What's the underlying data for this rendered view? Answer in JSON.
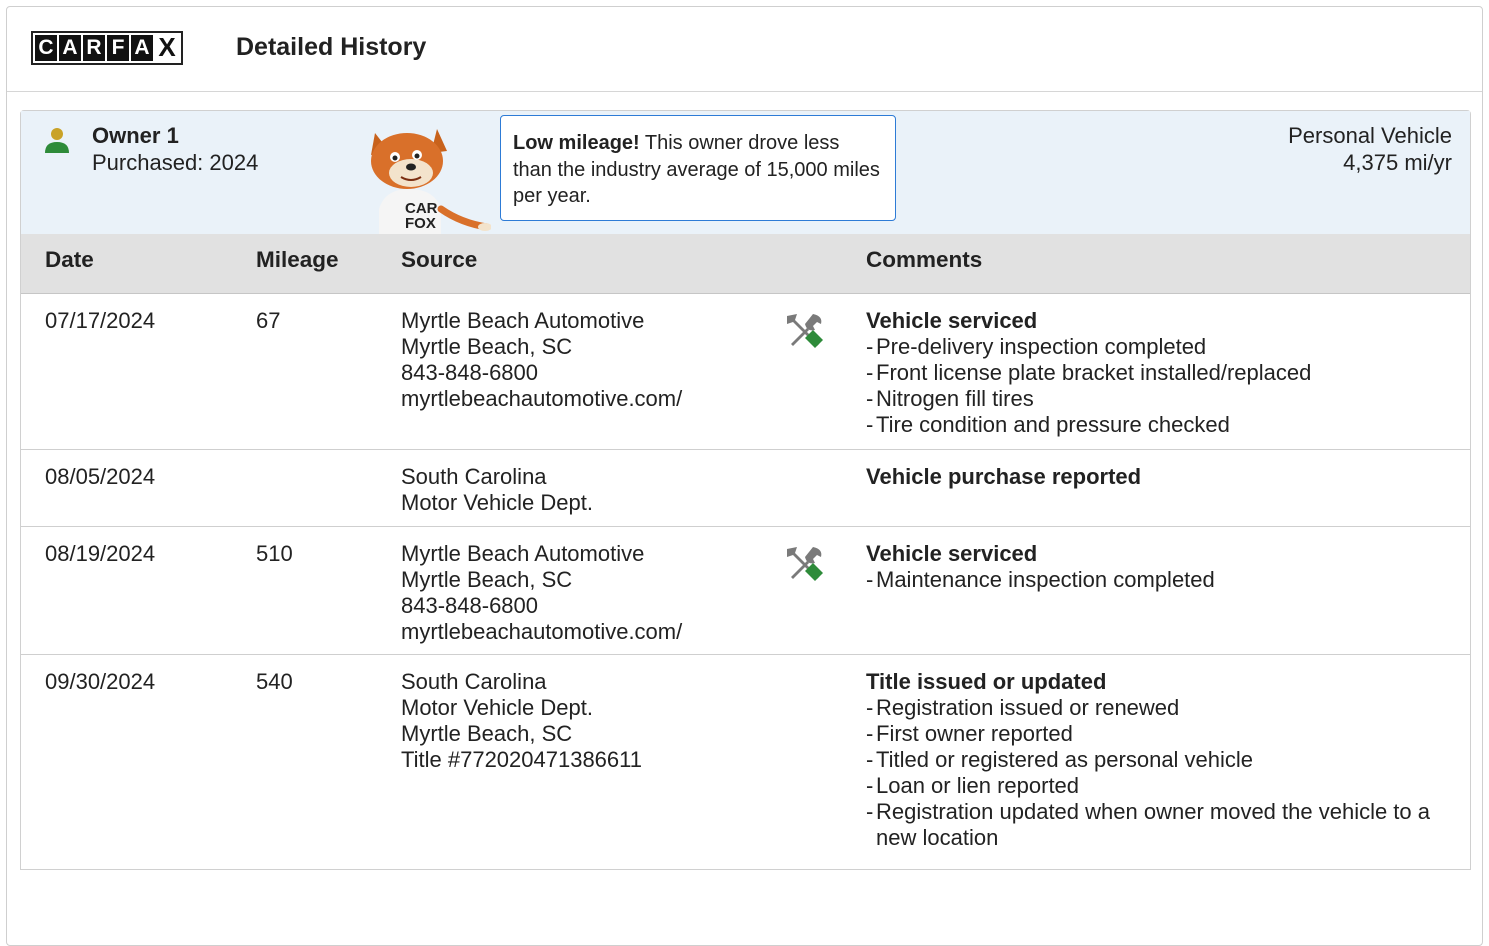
{
  "header": {
    "logo_letters": [
      "C",
      "A",
      "R",
      "F",
      "A",
      "X"
    ],
    "title": "Detailed History"
  },
  "owner": {
    "title": "Owner 1",
    "purchased": "Purchased: 2024",
    "callout_bold": "Low mileage!",
    "callout_text": " This owner drove less than the industry average of 15,000 miles per year.",
    "vehicle_type": "Personal Vehicle",
    "mileage_per_year": "4,375 mi/yr",
    "mascot_shirt": "CAR FOX",
    "person_icon": "person-icon",
    "person_icon_color": "#2e8b3a"
  },
  "table": {
    "columns": [
      "Date",
      "Mileage",
      "Source",
      "Comments"
    ],
    "rows": [
      {
        "date": "07/17/2024",
        "mileage": "67",
        "source": [
          "Myrtle Beach Automotive",
          "Myrtle Beach, SC",
          "843-848-6800",
          "myrtlebeachautomotive.com/"
        ],
        "icon": "service-tools-icon",
        "comment_title": "Vehicle serviced",
        "comment_items": [
          "Pre-delivery inspection completed",
          "Front license plate bracket installed/replaced",
          "Nitrogen fill tires",
          "Tire condition and pressure checked"
        ]
      },
      {
        "date": "08/05/2024",
        "mileage": "",
        "source": [
          "South Carolina",
          "Motor Vehicle Dept."
        ],
        "icon": "",
        "comment_title": "Vehicle purchase reported",
        "comment_items": []
      },
      {
        "date": "08/19/2024",
        "mileage": "510",
        "source": [
          "Myrtle Beach Automotive",
          "Myrtle Beach, SC",
          "843-848-6800",
          "myrtlebeachautomotive.com/"
        ],
        "icon": "service-tools-icon",
        "comment_title": "Vehicle serviced",
        "comment_items": [
          "Maintenance inspection completed"
        ]
      },
      {
        "date": "09/30/2024",
        "mileage": "540",
        "source": [
          "South Carolina",
          "Motor Vehicle Dept.",
          "Myrtle Beach, SC",
          "Title #772020471386611"
        ],
        "icon": "",
        "comment_title": "Title issued or updated",
        "comment_items": [
          "Registration issued or renewed",
          "First owner reported",
          "Titled or registered as personal vehicle",
          "Loan or lien reported",
          "Registration updated when owner moved the vehicle to a new location"
        ]
      }
    ]
  },
  "colors": {
    "accent_blue": "#2d7bd6",
    "panel_bg": "#eaf2f9",
    "header_bg": "#e1e1e1",
    "tool_green": "#2e8b3a",
    "tool_gray": "#7a7a7a"
  }
}
